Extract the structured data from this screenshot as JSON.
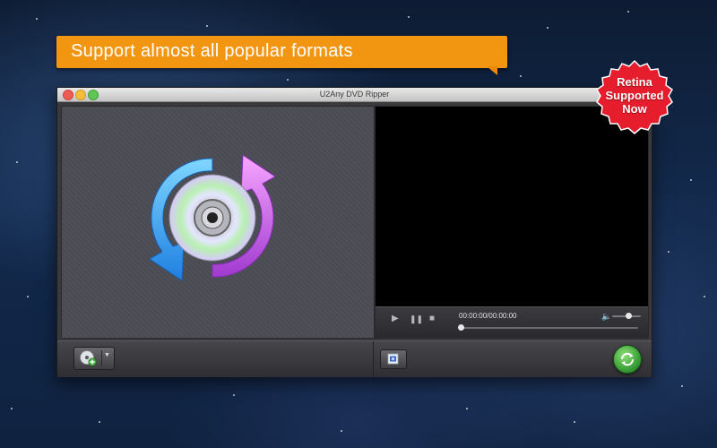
{
  "promo": {
    "banner_text": "Support almost all popular formats",
    "banner_color": "#f29612",
    "badge_lines": [
      "Retina",
      "Supported",
      "Now"
    ],
    "badge_color": "#e8202e"
  },
  "window": {
    "title": "U2Any DVD Ripper"
  },
  "player": {
    "timecode": "00:00:00/00:00:00",
    "seek_position": 0,
    "volume_level": 0.55
  },
  "icons": {
    "play": "play-icon",
    "pause": "pause-icon",
    "stop": "stop-icon",
    "volume": "speaker-icon",
    "load": "dvd-add-icon",
    "snapshot": "snapshot-icon",
    "convert": "convert-icon",
    "logo": "dvd-ripper-logo"
  }
}
